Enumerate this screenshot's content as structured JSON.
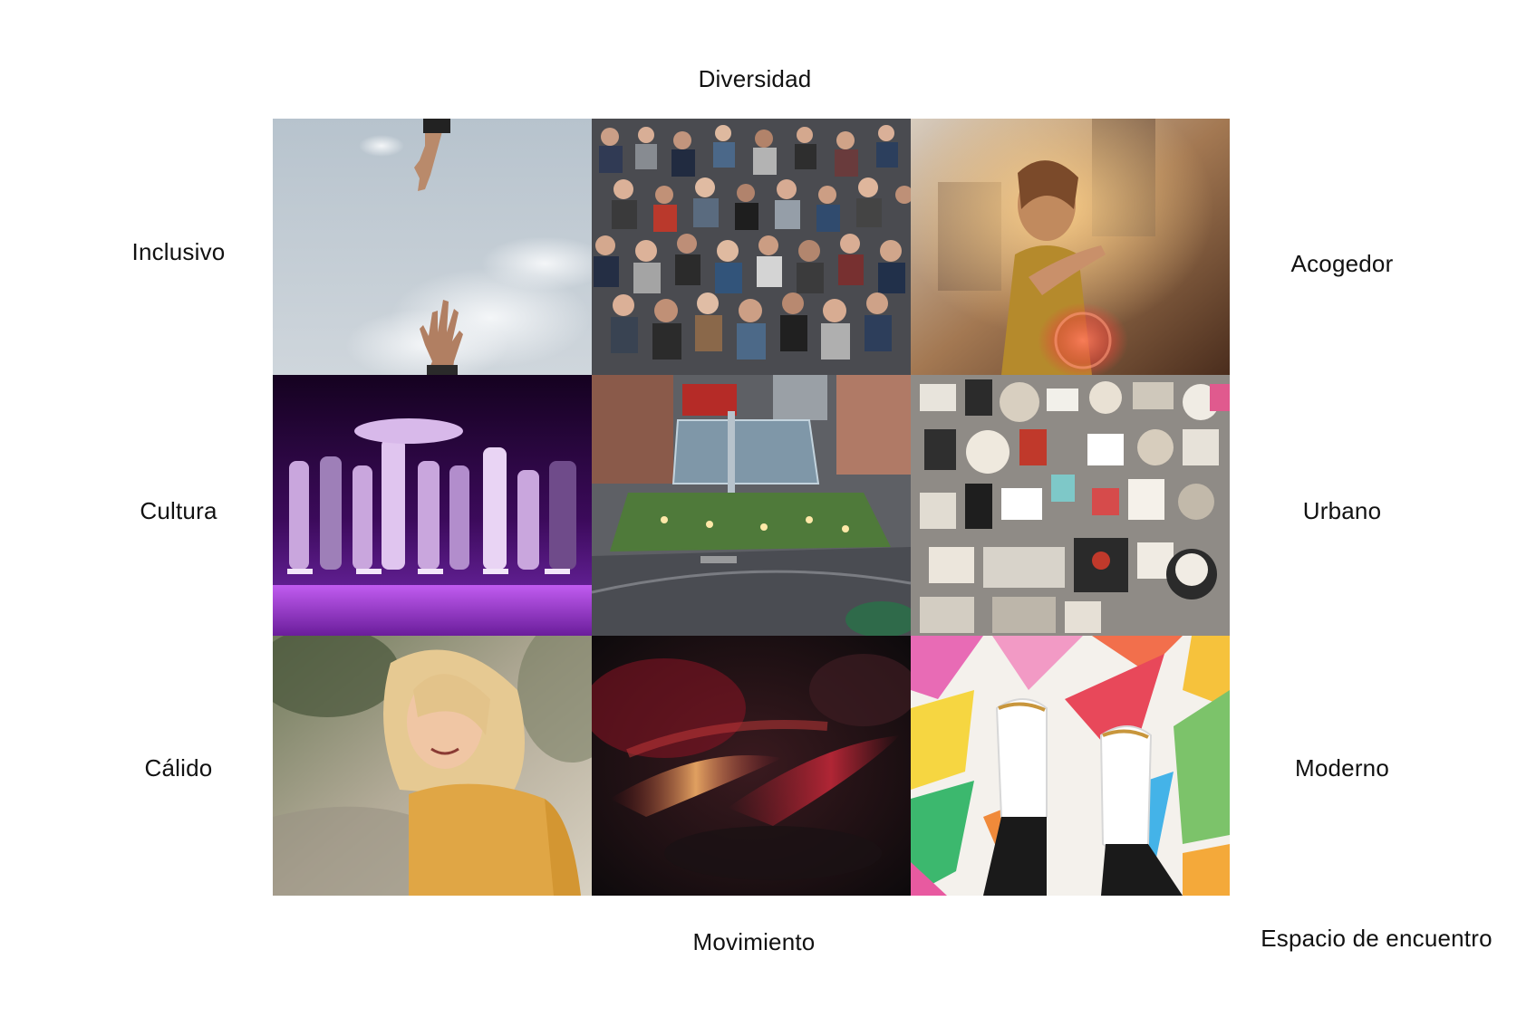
{
  "labels": {
    "top": "Diversidad",
    "bottom": "Movimiento",
    "left_1": "Inclusivo",
    "left_2": "Cultura",
    "left_3": "Cálido",
    "right_1": "Acogedor",
    "right_2": "Urbano",
    "right_3": "Moderno",
    "corner": "Espacio de encuentro"
  },
  "tiles": [
    {
      "name": "photo-hands-sky",
      "subject": "two hands reaching under a cloudy sky"
    },
    {
      "name": "photo-crowd",
      "subject": "large seated crowd"
    },
    {
      "name": "photo-offering-hand",
      "subject": "woman offering hand at sunset with lens flare"
    },
    {
      "name": "photo-dance-performance",
      "subject": "dancers on stage in purple light"
    },
    {
      "name": "photo-urban-building",
      "subject": "aerial view of modern building at dusk"
    },
    {
      "name": "photo-sticker-wall",
      "subject": "wall covered with stickers and graffiti"
    },
    {
      "name": "photo-smiling-woman",
      "subject": "smiling blonde woman in yellow shirt"
    },
    {
      "name": "photo-motion-blur",
      "subject": "abstract red motion blur lights"
    },
    {
      "name": "photo-colorful-floor",
      "subject": "white sneakers on colorful painted floor"
    }
  ],
  "colors": {
    "background": "#ffffff",
    "text": "#111111"
  }
}
